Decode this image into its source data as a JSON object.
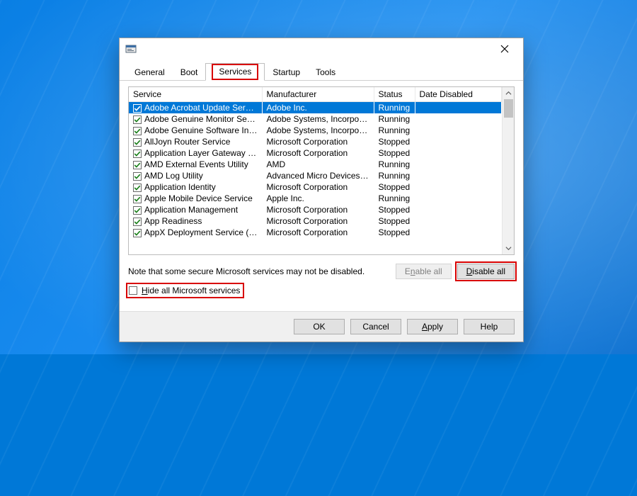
{
  "tabs": {
    "general": "General",
    "boot": "Boot",
    "services": "Services",
    "startup": "Startup",
    "tools": "Tools",
    "active": "services"
  },
  "columns": {
    "service": "Service",
    "manufacturer": "Manufacturer",
    "status": "Status",
    "date_disabled": "Date Disabled"
  },
  "rows": [
    {
      "service": "Adobe Acrobat Update Service",
      "manufacturer": "Adobe Inc.",
      "status": "Running",
      "date_disabled": "",
      "checked": true,
      "selected": true
    },
    {
      "service": "Adobe Genuine Monitor Service",
      "manufacturer": "Adobe Systems, Incorpora...",
      "status": "Running",
      "date_disabled": "",
      "checked": true
    },
    {
      "service": "Adobe Genuine Software Integri...",
      "manufacturer": "Adobe Systems, Incorpora...",
      "status": "Running",
      "date_disabled": "",
      "checked": true
    },
    {
      "service": "AllJoyn Router Service",
      "manufacturer": "Microsoft Corporation",
      "status": "Stopped",
      "date_disabled": "",
      "checked": true
    },
    {
      "service": "Application Layer Gateway Service",
      "manufacturer": "Microsoft Corporation",
      "status": "Stopped",
      "date_disabled": "",
      "checked": true
    },
    {
      "service": "AMD External Events Utility",
      "manufacturer": "AMD",
      "status": "Running",
      "date_disabled": "",
      "checked": true
    },
    {
      "service": "AMD Log Utility",
      "manufacturer": "Advanced Micro Devices, I...",
      "status": "Running",
      "date_disabled": "",
      "checked": true
    },
    {
      "service": "Application Identity",
      "manufacturer": "Microsoft Corporation",
      "status": "Stopped",
      "date_disabled": "",
      "checked": true
    },
    {
      "service": "Apple Mobile Device Service",
      "manufacturer": "Apple Inc.",
      "status": "Running",
      "date_disabled": "",
      "checked": true
    },
    {
      "service": "Application Management",
      "manufacturer": "Microsoft Corporation",
      "status": "Stopped",
      "date_disabled": "",
      "checked": true
    },
    {
      "service": "App Readiness",
      "manufacturer": "Microsoft Corporation",
      "status": "Stopped",
      "date_disabled": "",
      "checked": true
    },
    {
      "service": "AppX Deployment Service (AppX...",
      "manufacturer": "Microsoft Corporation",
      "status": "Stopped",
      "date_disabled": "",
      "checked": true
    }
  ],
  "note": "Note that some secure Microsoft services may not be disabled.",
  "buttons": {
    "enable_all_pre": "E",
    "enable_all_u": "n",
    "enable_all_post": "able all",
    "disable_all_pre": "",
    "disable_all_u": "D",
    "disable_all_post": "isable all"
  },
  "hide": {
    "pre": "",
    "u": "H",
    "post": "ide all Microsoft services",
    "checked": false
  },
  "bottom": {
    "ok": "OK",
    "cancel": "Cancel",
    "apply_pre": "",
    "apply_u": "A",
    "apply_post": "pply",
    "help": "Help"
  }
}
